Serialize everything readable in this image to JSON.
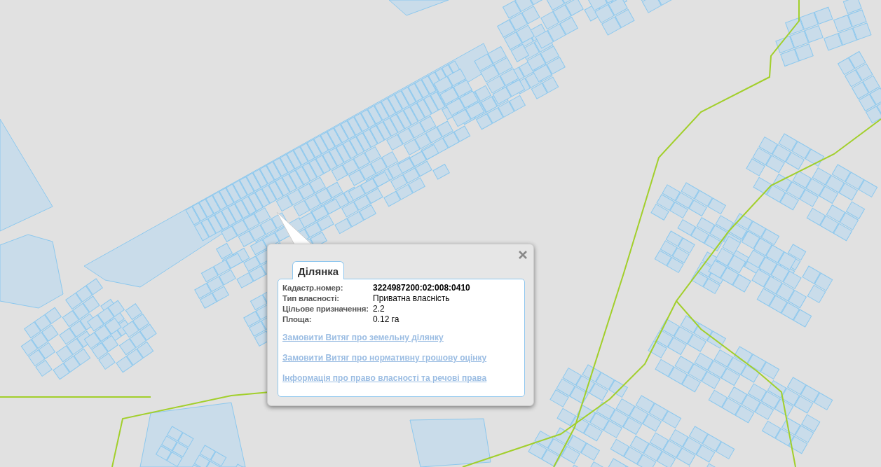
{
  "map": {
    "popup": {
      "tabs": [
        {
          "label": "Ділянка",
          "selected": true
        }
      ],
      "fields": [
        {
          "label": "Кадастр.номер:",
          "value": "3224987200:02:008:0410",
          "bold": true
        },
        {
          "label": "Тип власності:",
          "value": "Приватна власність",
          "bold": false
        },
        {
          "label": "Цільове призначення:",
          "value": "2.2",
          "bold": false
        },
        {
          "label": "Площа:",
          "value": "0.12 га",
          "bold": false
        }
      ],
      "links": [
        "Замовити Витяг про земельну ділянку",
        "Замовити Витяг про нормативну грошову оцінку",
        "Інформація про право власності та речові права"
      ]
    }
  }
}
